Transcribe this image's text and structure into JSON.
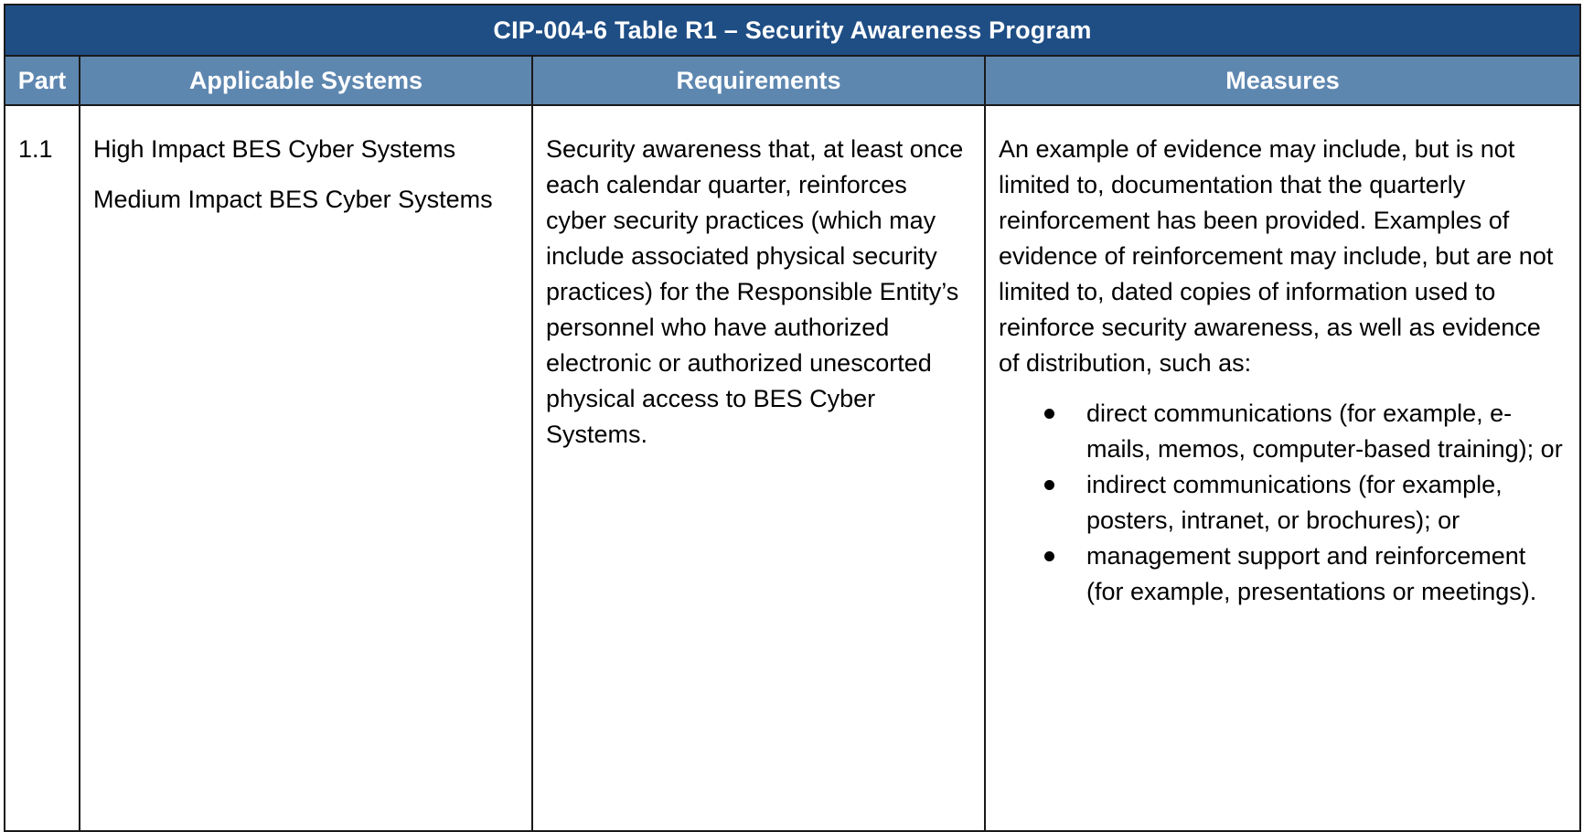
{
  "table": {
    "title": "CIP-004-6 Table R1 – Security Awareness Program",
    "headers": {
      "part": "Part",
      "systems": "Applicable Systems",
      "requirements": "Requirements",
      "measures": "Measures"
    },
    "rows": [
      {
        "part": "1.1",
        "systems": [
          "High Impact BES Cyber Systems",
          "Medium Impact BES Cyber Systems"
        ],
        "requirements": "Security awareness that, at least once each calendar quarter, reinforces cyber security practices (which may include associated physical security practices) for the Responsible Entity’s personnel who have authorized electronic or authorized unescorted physical access to BES Cyber Systems.",
        "measures_intro": "An example of evidence may include, but is not limited to, documentation that the quarterly reinforcement has been provided.  Examples of evidence of reinforcement may include, but are not limited to, dated copies of information used to reinforce security awareness, as well as evidence of distribution, such as:",
        "measures_bullets": [
          "direct communications (for example, e-mails, memos, computer-based training); or",
          "indirect communications (for example, posters, intranet, or brochures); or",
          "management support and reinforcement (for example, presentations or meetings)."
        ]
      }
    ]
  },
  "colors": {
    "title_bg": "#1f4e85",
    "header_bg": "#5e87b0",
    "header_text": "#ffffff",
    "border": "#1a1a1a"
  }
}
